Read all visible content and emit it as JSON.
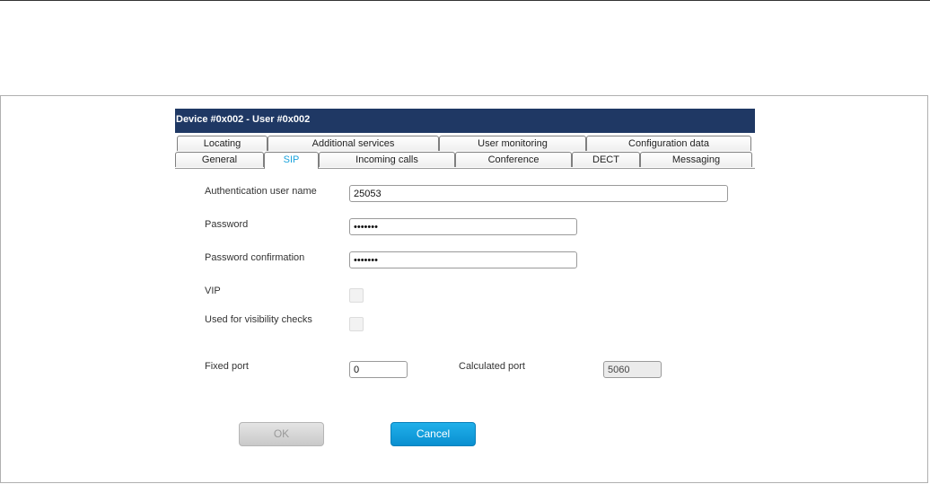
{
  "dialog": {
    "title": "Device #0x002 - User #0x002"
  },
  "tabs": {
    "row1": [
      "Locating",
      "Additional services",
      "User monitoring",
      "Configuration data"
    ],
    "row2": [
      "General",
      "SIP",
      "Incoming calls",
      "Conference",
      "DECT",
      "Messaging"
    ],
    "active": "SIP"
  },
  "form": {
    "auth_user_label": "Authentication user name",
    "auth_user_value": "25053",
    "password_label": "Password",
    "password_value": "•••••••",
    "password_confirm_label": "Password confirmation",
    "password_confirm_value": "•••••••",
    "vip_label": "VIP",
    "vip_checked": false,
    "visibility_label": "Used for visibility checks",
    "visibility_checked": false,
    "fixed_port_label": "Fixed port",
    "fixed_port_value": "0",
    "calculated_port_label": "Calculated port",
    "calculated_port_value": "5060"
  },
  "buttons": {
    "ok_label": "OK",
    "cancel_label": "Cancel"
  },
  "colors": {
    "titlebar": "#1f3864",
    "active_tab_text": "#1aa3dc",
    "cancel_button": "#0a8fd0"
  }
}
